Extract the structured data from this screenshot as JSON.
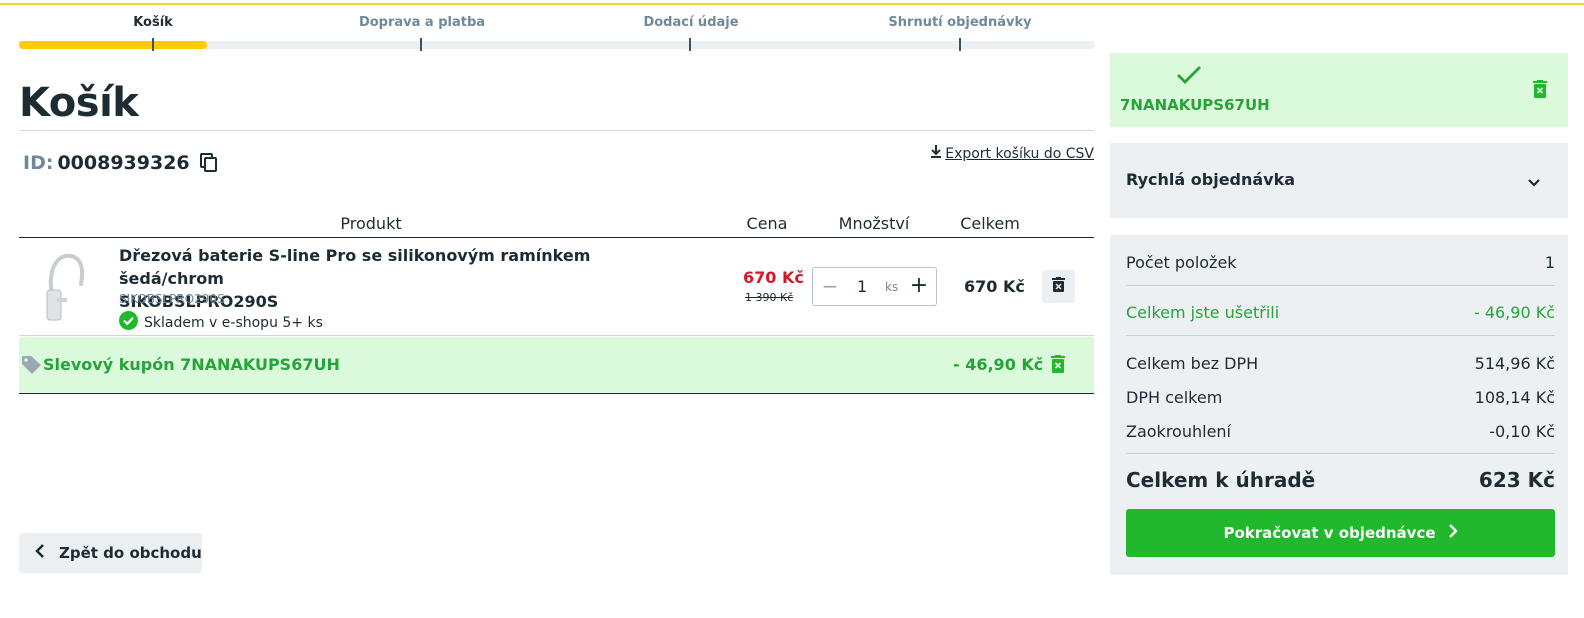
{
  "steps": [
    {
      "label": "Košík",
      "active": true
    },
    {
      "label": "Doprava a platba",
      "active": false
    },
    {
      "label": "Dodací údaje",
      "active": false
    },
    {
      "label": "Shrnutí objednávky",
      "active": false
    }
  ],
  "page_title": "Košík",
  "cart": {
    "id_label": "ID:",
    "id_value": "0008939326",
    "export_label": "Export košíku do CSV"
  },
  "table": {
    "headers": {
      "product": "Produkt",
      "price": "Cena",
      "quantity": "Množství",
      "total": "Celkem"
    },
    "items": [
      {
        "name_line1": "Dřezová baterie S-line Pro se silikonovým ramínkem šedá/chrom",
        "name_line2": "SIKOBSLPRO290S",
        "sku": "SIKOBSLPRO290S",
        "stock": "Skladem v e-shopu 5+ ks",
        "price": "670 Kč",
        "price_old": "1 390 Kč",
        "quantity": "1",
        "unit": "ks",
        "total": "670 Kč"
      }
    ],
    "coupon": {
      "label": "Slevový kupón 7NANAKUPS67UH",
      "value": "- 46,90 Kč"
    }
  },
  "back_button": "Zpět do obchodu",
  "sidebar": {
    "applied_coupon": "7NANAKUPS67UH",
    "quick_order": "Rychlá objednávka",
    "summary": {
      "item_count_label": "Počet položek",
      "item_count": "1",
      "saved_label": "Celkem jste ušetřili",
      "saved": "- 46,90 Kč",
      "no_vat_label": "Celkem bez DPH",
      "no_vat": "514,96 Kč",
      "vat_label": "DPH celkem",
      "vat": "108,14 Kč",
      "rounding_label": "Zaokrouhlení",
      "rounding": "-0,10 Kč",
      "grand_label": "Celkem k úhradě",
      "grand": "623 Kč"
    },
    "continue_button": "Pokračovat v objednávce"
  },
  "colors": {
    "accent": "#ffcc00",
    "green": "#22b82e",
    "discount": "#27a33a",
    "price_red": "#d6172b"
  }
}
